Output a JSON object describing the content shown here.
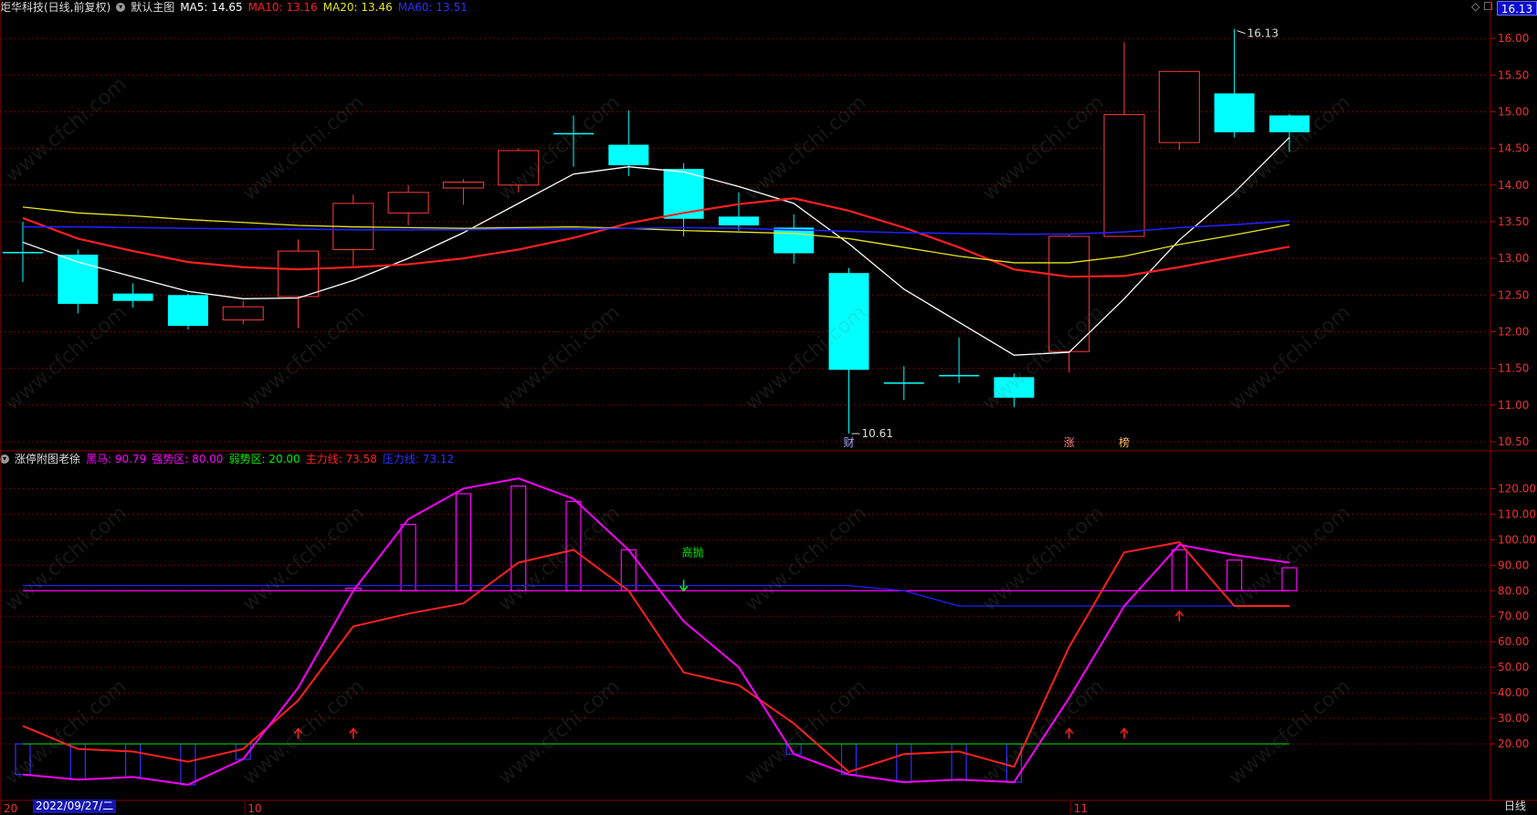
{
  "header_main": {
    "stock_name": "炬华科技(日线,前复权)",
    "chart_name": "默认主图",
    "ma5_label": "MA5: 14.65",
    "ma10_label": "MA10: 13.16",
    "ma20_label": "MA20: 13.46",
    "ma60_label": "MA60: 13.51"
  },
  "header_ind": {
    "name": "涨停附图老徐",
    "heima_label": "黑马: 90.79",
    "qiang_label": "强势区: 80.00",
    "ruo_label": "弱势区: 20.00",
    "zhuli_label": "主力线: 73.58",
    "yali_label": "压力线: 73.12"
  },
  "colors": {
    "up": "#ff3b3b",
    "down": "#00ffff",
    "ma5": "#ffffff",
    "ma10": "#ff2020",
    "ma20": "#e5e520",
    "ma60": "#2020ff",
    "heima": "#ff00ff",
    "qiang": "#ff00ff",
    "ruo": "#00cc00",
    "zhuli": "#ff2020",
    "yali": "#2020ff",
    "grid": "#7a0000"
  },
  "current_price_tag": "16.13",
  "period_label": "日线",
  "cursor_date": "2022/09/27/二",
  "x_labels": [
    "20",
    "10",
    "11"
  ],
  "watermark_text": "www.cfchi.com",
  "chart_data": [
    {
      "type": "candlestick",
      "title": "默认主图",
      "ylim": [
        10.4,
        16.3
      ],
      "yticks": [
        10.5,
        11.0,
        11.5,
        12.0,
        12.5,
        13.0,
        13.5,
        14.0,
        14.5,
        15.0,
        15.5,
        16.0
      ],
      "tick_labels": [
        "10.50",
        "11.00",
        "11.50",
        "12.00",
        "12.50",
        "13.00",
        "13.50",
        "14.00",
        "14.50",
        "15.00",
        "15.50",
        "16.00"
      ],
      "candles": [
        {
          "o": 13.08,
          "h": 13.5,
          "l": 12.68,
          "c": 13.08
        },
        {
          "o": 13.05,
          "h": 13.12,
          "l": 12.25,
          "c": 12.38
        },
        {
          "o": 12.52,
          "h": 12.66,
          "l": 12.33,
          "c": 12.42
        },
        {
          "o": 12.5,
          "h": 12.52,
          "l": 12.03,
          "c": 12.08
        },
        {
          "o": 12.16,
          "h": 12.42,
          "l": 12.1,
          "c": 12.34
        },
        {
          "o": 12.48,
          "h": 13.26,
          "l": 12.05,
          "c": 13.1
        },
        {
          "o": 13.12,
          "h": 13.87,
          "l": 12.9,
          "c": 13.75
        },
        {
          "o": 13.62,
          "h": 14.0,
          "l": 13.45,
          "c": 13.9
        },
        {
          "o": 13.96,
          "h": 14.08,
          "l": 13.73,
          "c": 14.04
        },
        {
          "o": 14.0,
          "h": 14.5,
          "l": 13.9,
          "c": 14.47
        },
        {
          "o": 14.7,
          "h": 14.95,
          "l": 14.25,
          "c": 14.7
        },
        {
          "o": 14.55,
          "h": 15.02,
          "l": 14.12,
          "c": 14.27
        },
        {
          "o": 14.22,
          "h": 14.3,
          "l": 13.3,
          "c": 13.54
        },
        {
          "o": 13.57,
          "h": 13.9,
          "l": 13.38,
          "c": 13.45
        },
        {
          "o": 13.42,
          "h": 13.6,
          "l": 12.93,
          "c": 13.07
        },
        {
          "o": 12.8,
          "h": 12.87,
          "l": 10.61,
          "c": 11.48
        },
        {
          "o": 11.3,
          "h": 11.53,
          "l": 11.07,
          "c": 11.3
        },
        {
          "o": 11.4,
          "h": 11.92,
          "l": 11.3,
          "c": 11.4
        },
        {
          "o": 11.38,
          "h": 11.43,
          "l": 10.97,
          "c": 11.1
        },
        {
          "o": 11.73,
          "h": 13.33,
          "l": 11.44,
          "c": 13.3
        },
        {
          "o": 13.3,
          "h": 15.95,
          "l": 13.3,
          "c": 14.96
        },
        {
          "o": 14.58,
          "h": 15.56,
          "l": 14.48,
          "c": 15.55
        },
        {
          "o": 15.25,
          "h": 16.13,
          "l": 14.65,
          "c": 14.72
        },
        {
          "o": 14.95,
          "h": 14.97,
          "l": 14.45,
          "c": 14.72
        }
      ],
      "series": [
        {
          "name": "MA5",
          "values": [
            13.22,
            12.95,
            12.75,
            12.55,
            12.45,
            12.46,
            12.7,
            13.0,
            13.35,
            13.75,
            14.15,
            14.25,
            14.18,
            13.98,
            13.75,
            13.2,
            12.58,
            12.13,
            11.68,
            11.72,
            12.45,
            13.25,
            13.9,
            14.65
          ]
        },
        {
          "name": "MA10",
          "values": [
            13.55,
            13.27,
            13.1,
            12.95,
            12.88,
            12.85,
            12.88,
            12.92,
            13.0,
            13.12,
            13.28,
            13.48,
            13.62,
            13.74,
            13.82,
            13.65,
            13.42,
            13.15,
            12.85,
            12.75,
            12.76,
            12.88,
            13.02,
            13.16
          ]
        },
        {
          "name": "MA20",
          "values": [
            13.7,
            13.62,
            13.58,
            13.53,
            13.49,
            13.45,
            13.43,
            13.42,
            13.41,
            13.42,
            13.43,
            13.41,
            13.38,
            13.36,
            13.34,
            13.27,
            13.15,
            13.03,
            12.94,
            12.94,
            13.03,
            13.19,
            13.32,
            13.46
          ]
        },
        {
          "name": "MA60",
          "values": [
            13.43,
            13.43,
            13.42,
            13.41,
            13.4,
            13.4,
            13.39,
            13.39,
            13.39,
            13.4,
            13.4,
            13.41,
            13.42,
            13.41,
            13.39,
            13.37,
            13.35,
            13.34,
            13.33,
            13.33,
            13.36,
            13.42,
            13.46,
            13.51
          ]
        }
      ],
      "annotations": {
        "high_label": "16.13",
        "low_label": "10.61",
        "events": [
          {
            "index": 15,
            "text": "财"
          },
          {
            "index": 19,
            "text": "涨"
          },
          {
            "index": 20,
            "text": "榜"
          }
        ]
      }
    },
    {
      "type": "line",
      "title": "涨停附图老徐",
      "ylim": [
        0,
        128
      ],
      "yticks": [
        20,
        30,
        40,
        50,
        60,
        70,
        80,
        90,
        100,
        110,
        120
      ],
      "tick_labels": [
        "20.00",
        "30.00",
        "40.00",
        "50.00",
        "60.00",
        "70.00",
        "80.00",
        "90.00",
        "100.00",
        "110.00",
        "120.00"
      ],
      "series": [
        {
          "name": "黑马",
          "values": [
            8,
            6,
            7,
            4,
            14,
            42,
            80,
            108,
            120,
            124,
            116,
            96,
            68,
            50,
            16,
            8,
            5,
            6,
            5,
            38,
            74,
            98,
            94,
            91
          ]
        },
        {
          "name": "主力线",
          "values": [
            27,
            18,
            17,
            13,
            18,
            37,
            66,
            71,
            75,
            91,
            96,
            80,
            48,
            43,
            28,
            9,
            16,
            17,
            11,
            58,
            95,
            99,
            74,
            74
          ]
        },
        {
          "name": "压力线",
          "values": [
            82,
            82,
            82,
            82,
            82,
            82,
            82,
            82,
            82,
            82,
            82,
            82,
            82,
            82,
            82,
            82,
            80,
            74,
            74,
            74,
            74,
            74,
            74,
            74
          ]
        },
        {
          "name": "强势区",
          "values": [
            80,
            80,
            80,
            80,
            80,
            80,
            80,
            80,
            80,
            80,
            80,
            80,
            80,
            80,
            80,
            80,
            80,
            80,
            80,
            80,
            80,
            80,
            80,
            80
          ]
        },
        {
          "name": "弱势区",
          "values": [
            20,
            20,
            20,
            20,
            20,
            20,
            20,
            20,
            20,
            20,
            20,
            20,
            20,
            20,
            20,
            20,
            20,
            20,
            20,
            20,
            20,
            20,
            20,
            20
          ]
        }
      ],
      "columns": [
        {
          "index": 0,
          "value": 20
        },
        {
          "index": 1,
          "value": 20
        },
        {
          "index": 2,
          "value": 20
        },
        {
          "index": 3,
          "value": 20
        },
        {
          "index": 4,
          "value": 20
        },
        {
          "index": 6,
          "value": 81
        },
        {
          "index": 7,
          "value": 106
        },
        {
          "index": 8,
          "value": 118
        },
        {
          "index": 9,
          "value": 121
        },
        {
          "index": 10,
          "value": 115
        },
        {
          "index": 11,
          "value": 96
        },
        {
          "index": 14,
          "value": 20
        },
        {
          "index": 15,
          "value": 20
        },
        {
          "index": 16,
          "value": 20
        },
        {
          "index": 17,
          "value": 20
        },
        {
          "index": 18,
          "value": 20
        },
        {
          "index": 21,
          "value": 96
        },
        {
          "index": 22,
          "value": 92
        },
        {
          "index": 23,
          "value": 89
        }
      ],
      "up_arrows": [
        5,
        6,
        19,
        20,
        21
      ],
      "down_arrows": [
        {
          "index": 12,
          "text": "高抛"
        }
      ]
    }
  ]
}
